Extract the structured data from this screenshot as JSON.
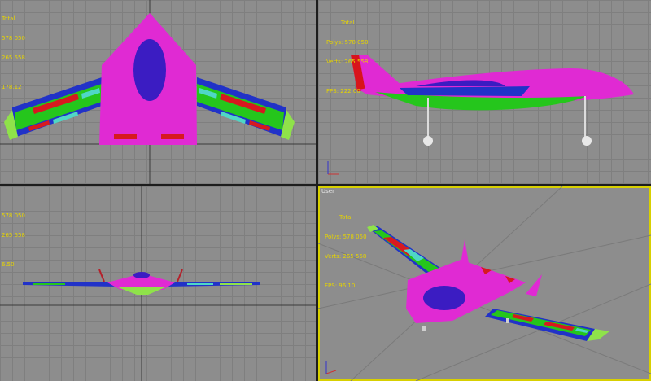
{
  "viewports": {
    "top": {
      "stats": {
        "title": "Total",
        "polys": "578 050",
        "verts": "265 558",
        "fps": "178.12"
      }
    },
    "front": {
      "stats": {
        "title": "Total",
        "polys": "Polys: 578 050",
        "verts": "Verts: 265 558",
        "fps": "FPS:   222.00"
      }
    },
    "left": {
      "stats": {
        "title": "",
        "polys": "578 050",
        "verts": "265 558",
        "fps": "6.50"
      }
    },
    "user": {
      "label": "User",
      "stats": {
        "title": "Total",
        "polys": "Polys: 578 050",
        "verts": "Verts: 265 558",
        "fps": "FPS:   96.10"
      }
    }
  },
  "colors": {
    "fuselage": "#e02ad3",
    "canopy": "#3b1cc2",
    "wing_green": "#25c61c",
    "wing_blue": "#2132c8",
    "panel_red": "#d7191f",
    "panel_cyan": "#4fd7c6",
    "tail_red": "#d8141b",
    "gear_wheel": "#e8e8e8",
    "active_border": "#d8d000"
  }
}
